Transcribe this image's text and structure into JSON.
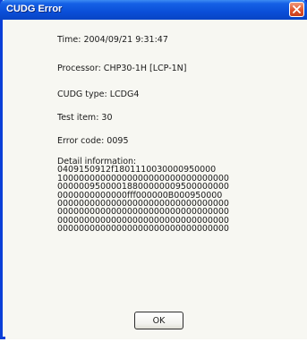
{
  "window": {
    "title": "CUDG Error"
  },
  "info": {
    "time": "Time: 2004/09/21  9:31:47",
    "processor": "Processor: CHP30-1H [LCP-1N]",
    "cudg_type": "CUDG type: LCDG4",
    "test_item": "Test item:   30",
    "error_code": "Error code: 0095"
  },
  "detail": {
    "label": "Detail information:",
    "lines": [
      "0409150912f1801110030000950000",
      "10000000000000000000000000000000",
      "00000095000018800000009500000000",
      "0000000000000fff000000B000950000",
      "00000000000000000000000000000000",
      "00000000000000000000000000000000",
      "00000000000000000000000000000000",
      "00000000000000000000000000000000"
    ]
  },
  "buttons": {
    "ok_label": "OK"
  },
  "colors": {
    "titlebar": "#0a4fd8",
    "close_button": "#e0542c",
    "dialog_background": "#f7f7f2"
  }
}
